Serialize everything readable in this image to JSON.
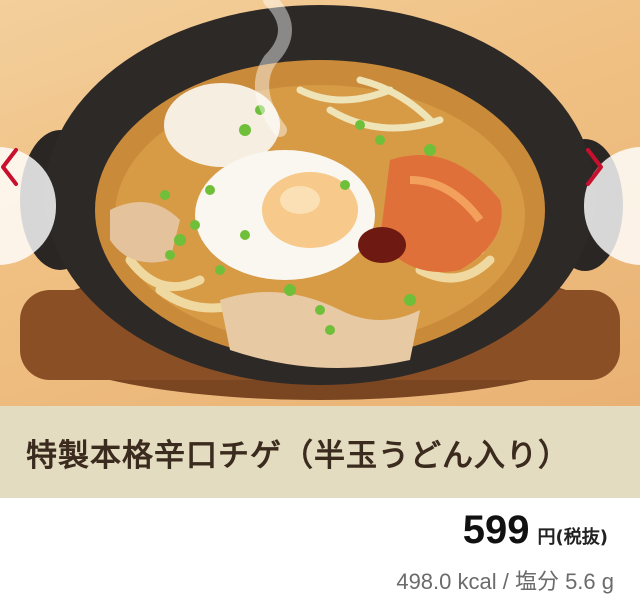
{
  "product": {
    "image_subject": "noodle-stew-photo",
    "title": "特製本格辛口チゲ（半玉うどん入り）",
    "price_value": "599",
    "price_unit": "円(税抜)",
    "nutrition": "498.0 kcal / 塩分 5.6 g"
  },
  "carousel": {
    "prev_icon": "chevron-left-icon",
    "next_icon": "chevron-right-icon"
  },
  "colors": {
    "arrow": "#c8102e",
    "title_bar": "#e4dcc0",
    "title_text": "#3a2b1e"
  }
}
